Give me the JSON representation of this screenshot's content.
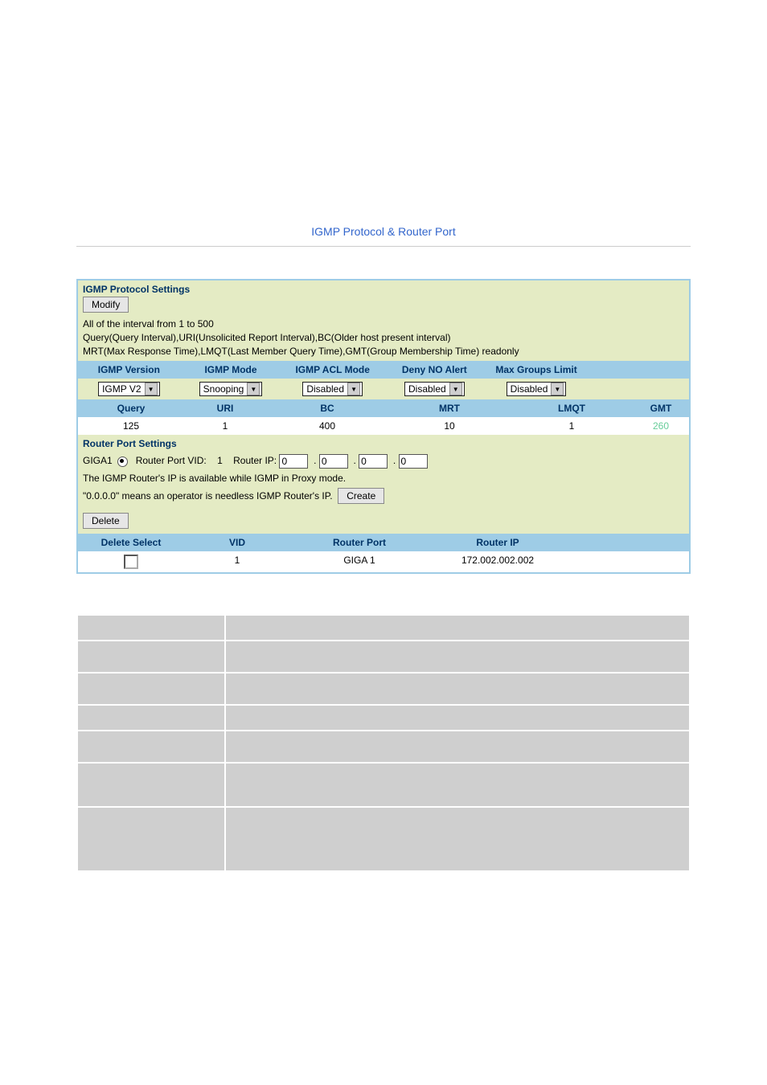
{
  "page": {
    "title": "IGMP Protocol & Router Port"
  },
  "protocol": {
    "heading": "IGMP Protocol Settings",
    "modify_label": "Modify",
    "info_line1": "All of the interval from 1 to 500",
    "info_line2": "Query(Query Interval),URI(Unsolicited Report Interval),BC(Older host present interval)",
    "info_line3": "MRT(Max Response Time),LMQT(Last Member Query Time),GMT(Group Membership Time) readonly",
    "cols1": {
      "version": "IGMP Version",
      "mode": "IGMP Mode",
      "acl": "IGMP ACL Mode",
      "deny": "Deny NO Alert",
      "maxg": "Max Groups Limit"
    },
    "vals1": {
      "version": "IGMP V2",
      "mode": "Snooping",
      "acl": "Disabled",
      "deny": "Disabled",
      "maxg": "Disabled"
    },
    "cols2": {
      "query": "Query",
      "uri": "URI",
      "bc": "BC",
      "mrt": "MRT",
      "lmqt": "LMQT",
      "gmt": "GMT"
    },
    "vals2": {
      "query": "125",
      "uri": "1",
      "bc": "400",
      "mrt": "10",
      "lmqt": "1",
      "gmt": "260"
    }
  },
  "router": {
    "heading": "Router Port Settings",
    "giga_label": "GIGA1",
    "vid_label": "Router Port VID:",
    "vid_value": "1",
    "ip_label": "Router IP:",
    "ip": [
      "0",
      "0",
      "0",
      "0"
    ],
    "note1": "The IGMP Router's IP is available while IGMP in Proxy mode.",
    "note2": "\"0.0.0.0\" means an operator is needless IGMP Router's IP.",
    "create_label": "Create",
    "delete_label": "Delete",
    "cols": {
      "del": "Delete Select",
      "vid": "VID",
      "port": "Router Port",
      "ip": "Router IP"
    },
    "row": {
      "vid": "1",
      "port": "GIGA 1",
      "ip": "172.002.002.002"
    }
  },
  "unknown_table": {
    "rows": 7
  }
}
